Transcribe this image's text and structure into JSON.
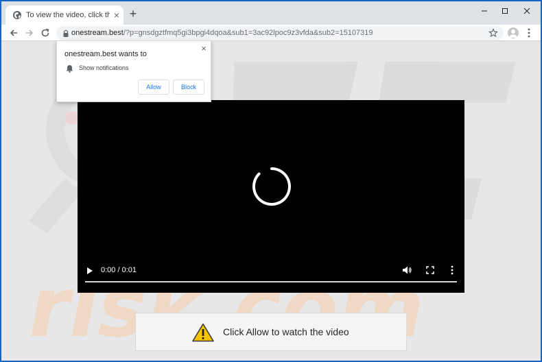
{
  "tab": {
    "title": "To view the video, click the Allow",
    "close_glyph": "×",
    "favicon": "globe-icon"
  },
  "new_tab_glyph": "+",
  "window_controls": [
    "minimize-icon",
    "maximize-icon",
    "close-icon"
  ],
  "toolbar": {
    "url_host": "onestream.best",
    "url_path": "/?p=gnsdgztfmq5gi3bpgi4dqoa&sub1=3ac92lpoc9z3vfda&sub2=15107319",
    "icons": [
      "back-arrow-icon",
      "forward-arrow-icon",
      "reload-icon",
      "lock-icon",
      "star-icon",
      "avatar-icon",
      "menu-dots-icon"
    ]
  },
  "prompt": {
    "title": "onestream.best wants to",
    "message": "Show notifications",
    "allow_label": "Allow",
    "block_label": "Block",
    "close_glyph": "×"
  },
  "video": {
    "time": "0:00 / 0:01",
    "progress": 0,
    "icons": [
      "play-icon",
      "volume-icon",
      "fullscreen-icon",
      "more-options-icon",
      "loading-spinner-icon"
    ]
  },
  "banner": {
    "text": "Click Allow to watch the video",
    "icon": "warning-icon"
  },
  "colors": {
    "window_frame": "#1565c0",
    "tab_strip": "#dee1e6",
    "page_background": "#e7e7e9",
    "link_blue": "#1a73e8",
    "warning_yellow": "#f5c400"
  }
}
